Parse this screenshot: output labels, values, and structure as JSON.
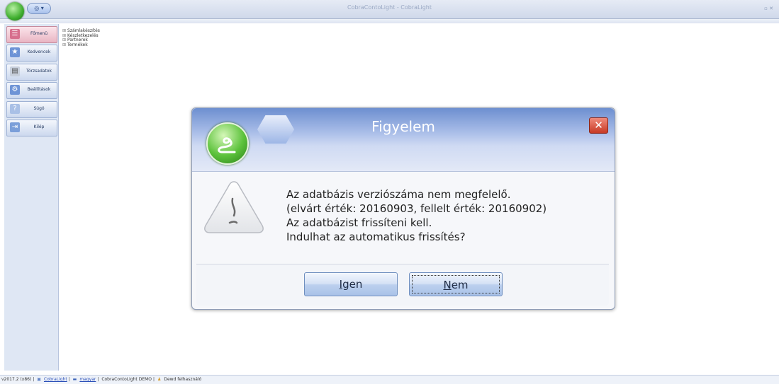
{
  "window": {
    "title": "CobraContoLight - CobraLight",
    "quick_button": "◎ ▾",
    "controls": "▫ ✕"
  },
  "sidebar": {
    "items": [
      {
        "label": "Főmenü",
        "icon": "menu-icon",
        "active": true
      },
      {
        "label": "Kedvencek",
        "icon": "star-icon",
        "active": false
      },
      {
        "label": "Törzsadatok",
        "icon": "table-icon",
        "active": false
      },
      {
        "label": "Beállítások",
        "icon": "gear-icon",
        "active": false
      },
      {
        "label": "Súgó",
        "icon": "help-icon",
        "active": false
      },
      {
        "label": "Kilép",
        "icon": "exit-icon",
        "active": false
      }
    ]
  },
  "tree": {
    "items": [
      {
        "expander": "⊞",
        "label": "Számlakészítés"
      },
      {
        "expander": "⊞",
        "label": "Készletkezelés"
      },
      {
        "expander": "⊞",
        "label": "Partnerek"
      },
      {
        "expander": "⊞",
        "label": "Termékek"
      }
    ]
  },
  "dialog": {
    "title": "Figyelem",
    "close": "✕",
    "message": [
      "Az adatbázis verziószáma nem megfelelő.",
      "(elvárt érték: 20160903, fellelt érték: 20160902)",
      "Az adatbázist frissíteni kell.",
      "Indulhat az automatikus frissítés?"
    ],
    "buttons": {
      "yes": {
        "mnemonic": "I",
        "rest": "gen"
      },
      "no": {
        "mnemonic": "N",
        "rest": "em"
      }
    }
  },
  "statusbar": {
    "version": "v2017.2 (x86)",
    "app_link": "CobraLight",
    "language_link": "magyar",
    "company": "CobraContoLight DEMO",
    "user": "Dewd felhasználó"
  },
  "colors": {
    "accent": "#6d8fd0",
    "close_red": "#c73a25",
    "logo_green": "#3fae2e"
  }
}
